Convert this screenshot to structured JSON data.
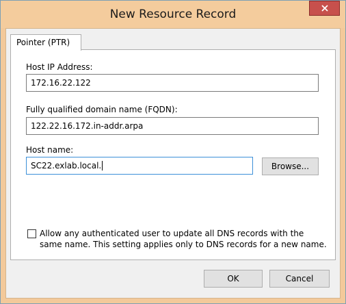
{
  "window": {
    "title": "New Resource Record"
  },
  "tabs": [
    {
      "label": "Pointer (PTR)"
    }
  ],
  "fields": {
    "host_ip": {
      "label": "Host IP Address:",
      "value": "172.16.22.122"
    },
    "fqdn": {
      "label": "Fully qualified domain name (FQDN):",
      "value": "122.22.16.172.in-addr.arpa"
    },
    "host_name": {
      "label": "Host name:",
      "value": "SC22.exlab.local."
    }
  },
  "browse_button": {
    "label": "Browse..."
  },
  "allow_update": {
    "checked": false,
    "label": "Allow any authenticated user to update all DNS records with the same name. This setting applies only to DNS records for a new name."
  },
  "footer": {
    "ok_label": "OK",
    "cancel_label": "Cancel"
  },
  "colors": {
    "titlebar": "#f4cc9d",
    "close_button": "#c7504c",
    "focus_border": "#3b8fd8"
  },
  "icons": {
    "close": "close-icon"
  }
}
